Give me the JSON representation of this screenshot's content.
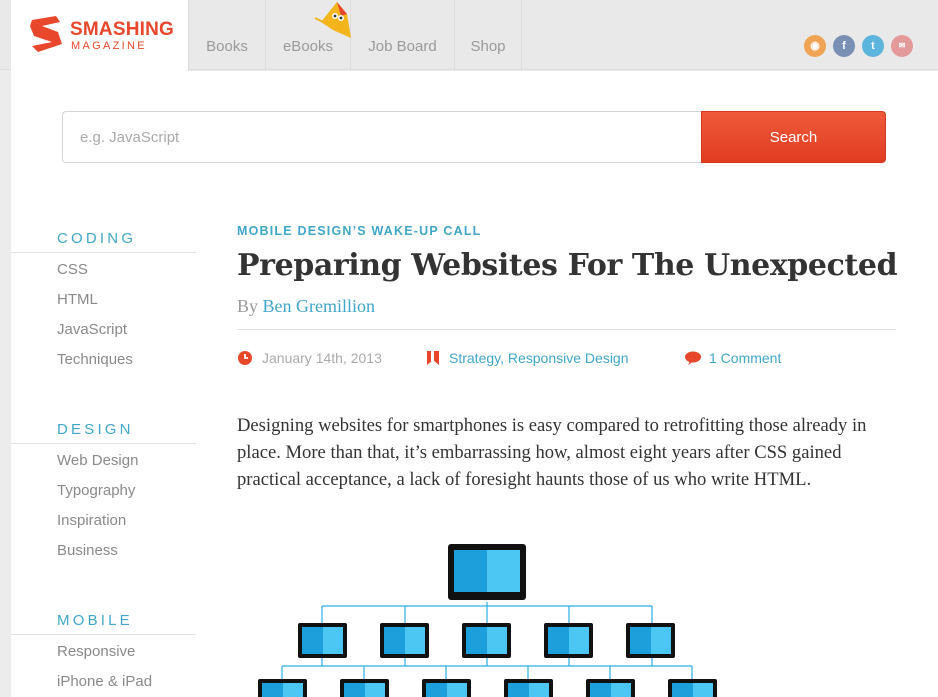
{
  "header": {
    "logo": {
      "word1": "SMASHING",
      "word2": "MAGAZINE"
    },
    "nav": [
      "Books",
      "eBooks",
      "Job Board",
      "Shop"
    ],
    "social": [
      "rss-icon",
      "facebook-icon",
      "twitter-icon",
      "email-icon"
    ]
  },
  "search": {
    "placeholder": "e.g. JavaScript",
    "button": "Search"
  },
  "sidebar": {
    "sections": [
      {
        "title": "CODING",
        "links": [
          "CSS",
          "HTML",
          "JavaScript",
          "Techniques"
        ]
      },
      {
        "title": "DESIGN",
        "links": [
          "Web Design",
          "Typography",
          "Inspiration",
          "Business"
        ]
      },
      {
        "title": "MOBILE",
        "links": [
          "Responsive",
          "iPhone & iPad"
        ]
      }
    ]
  },
  "article": {
    "kicker": "MOBILE DESIGN’S WAKE-UP CALL",
    "title": "Preparing Websites For The Unexpected",
    "by": "By",
    "author": "Ben Gremillion",
    "date": "January 14th, 2013",
    "categories": "Strategy, Responsive Design",
    "comments": "1 Comment",
    "body": "Designing websites for smartphones is easy compared to retrofitting those already in place. More than that, it’s embarrassing how, almost eight years after CSS gained practical acceptance, a lack of foresight haunts those of us who write HTML."
  },
  "colors": {
    "accent": "#41a7c9",
    "brand": "#e8472c",
    "screen": "#2aaee6"
  }
}
